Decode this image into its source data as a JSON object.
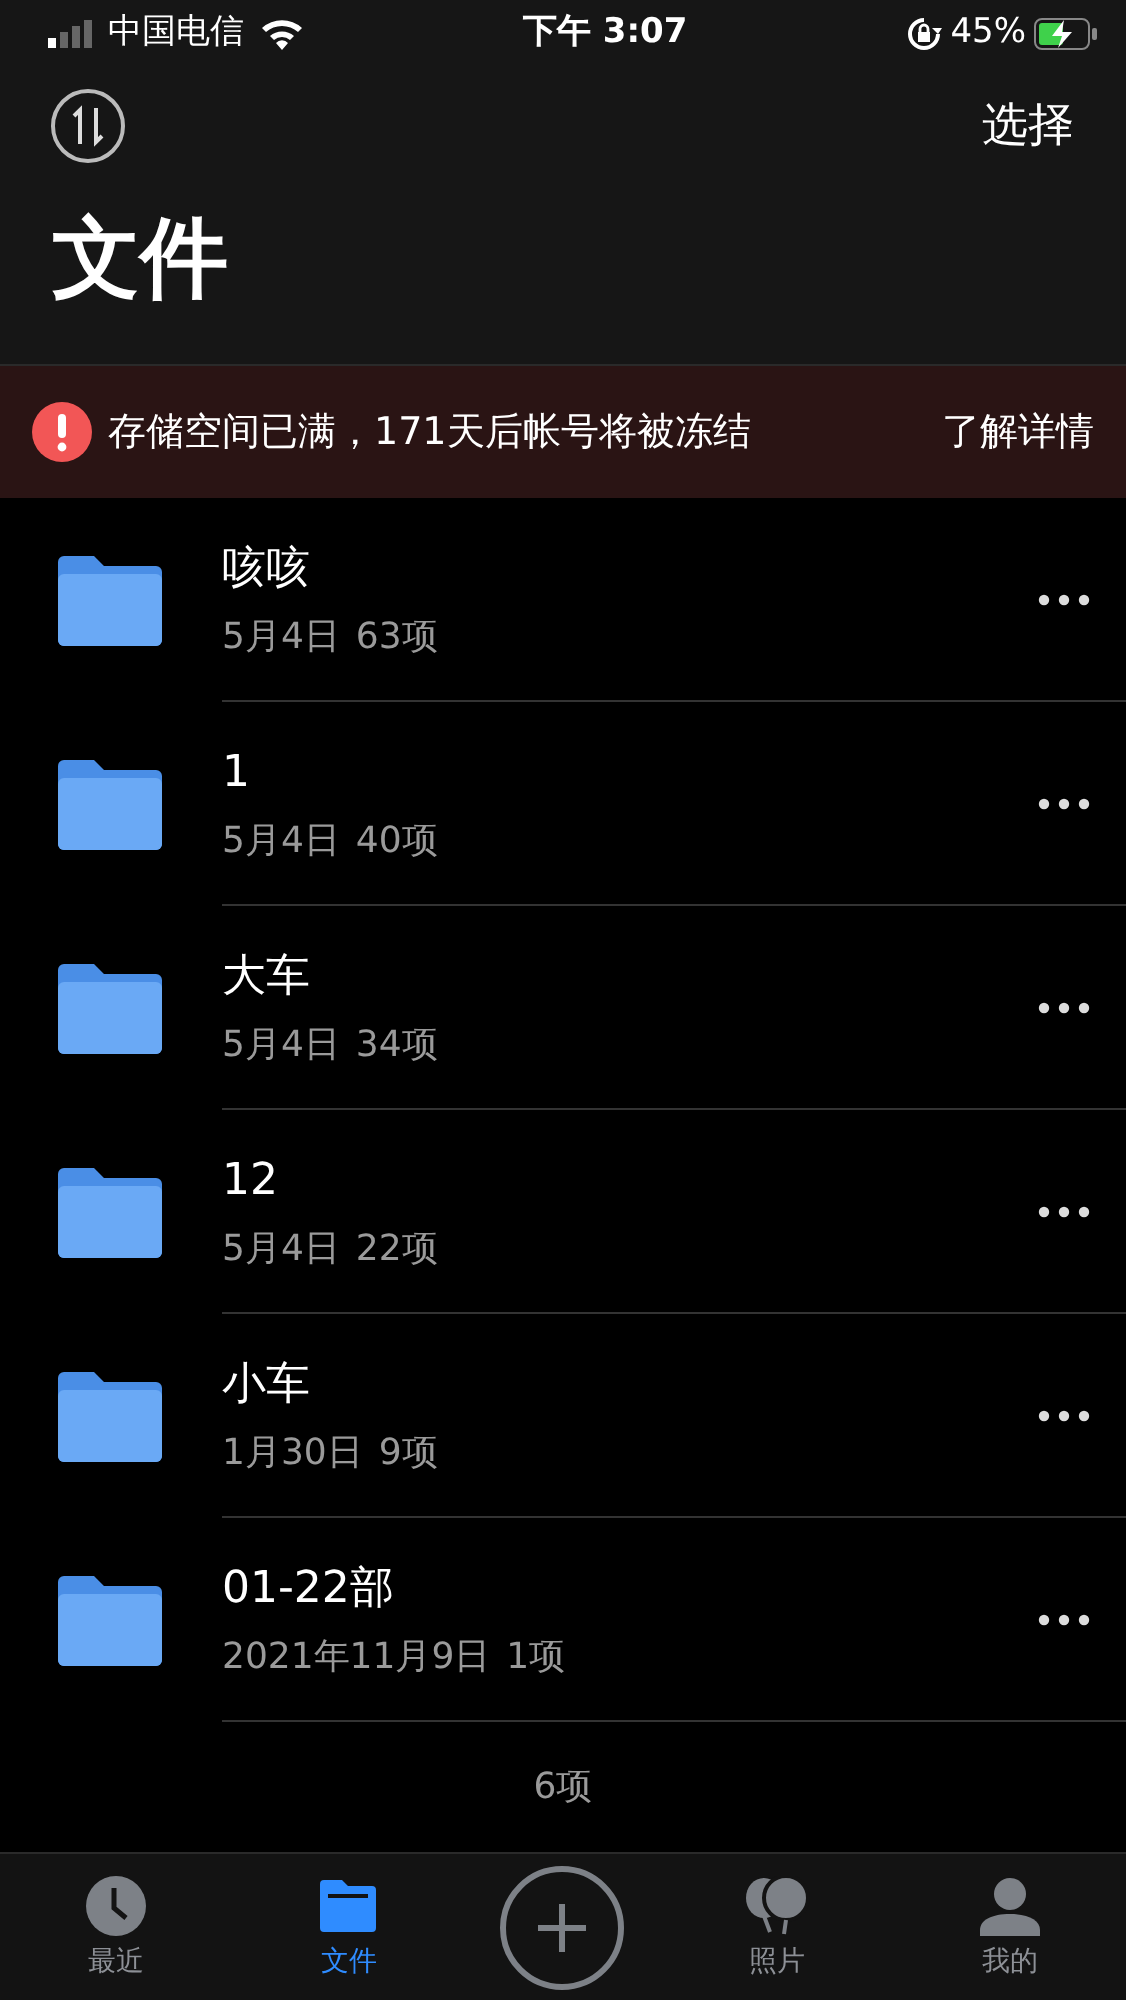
{
  "status_bar": {
    "carrier": "中国电信",
    "time": "下午 3:07",
    "battery": "45%"
  },
  "header": {
    "select": "选择",
    "title": "文件"
  },
  "alert": {
    "message": "存储空间已满，171天后帐号将被冻结",
    "link": "了解详情"
  },
  "folders": [
    {
      "name": "咳咳",
      "date": "5月4日",
      "count": "63项"
    },
    {
      "name": "1",
      "date": "5月4日",
      "count": "40项"
    },
    {
      "name": "大车",
      "date": "5月4日",
      "count": "34项"
    },
    {
      "name": "12",
      "date": "5月4日",
      "count": "22项"
    },
    {
      "name": "小车",
      "date": "1月30日",
      "count": "9项"
    },
    {
      "name": "01-22部",
      "date": "2021年11月9日",
      "count": "1项"
    }
  ],
  "footer": "6项",
  "tabs": [
    {
      "kind": "recent",
      "label": "最近",
      "selected": false
    },
    {
      "kind": "files",
      "label": "文件",
      "selected": true
    },
    {
      "kind": "add",
      "selected": false
    },
    {
      "kind": "photos",
      "label": "照片",
      "selected": false
    },
    {
      "kind": "me",
      "label": "我的",
      "selected": false
    }
  ]
}
